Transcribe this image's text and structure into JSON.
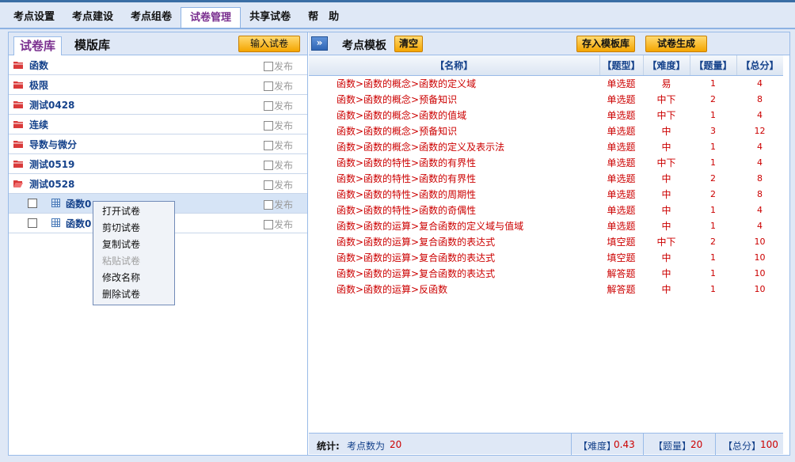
{
  "menu": {
    "tabs": [
      {
        "label": "考点设置"
      },
      {
        "label": "考点建设"
      },
      {
        "label": "考点组卷"
      },
      {
        "label": "试卷管理"
      },
      {
        "label": "共享试卷"
      },
      {
        "label": "帮　助"
      }
    ],
    "active_index": 3
  },
  "left": {
    "tabs": {
      "papers": "试卷库",
      "templates": "模版库"
    },
    "import_button": "输入试卷",
    "publish_label": "发布",
    "folders": [
      {
        "name": "函数"
      },
      {
        "name": "极限"
      },
      {
        "name": "测试0428"
      },
      {
        "name": "连续"
      },
      {
        "name": "导数与微分"
      },
      {
        "name": "测试0519"
      },
      {
        "name": "测试0528"
      }
    ],
    "papers": [
      {
        "name": "函数0"
      },
      {
        "name": "函数0"
      }
    ],
    "context_menu": [
      {
        "label": "打开试卷",
        "enabled": true
      },
      {
        "label": "剪切试卷",
        "enabled": true
      },
      {
        "label": "复制试卷",
        "enabled": true
      },
      {
        "label": "粘贴试卷",
        "enabled": false
      },
      {
        "label": "修改名称",
        "enabled": true
      },
      {
        "label": "删除试卷",
        "enabled": true
      }
    ]
  },
  "right": {
    "expand_icon": "double-chevron-right-icon",
    "title": "考点模板",
    "clear_button": "清空",
    "save_template_button": "存入模板库",
    "generate_button": "试卷生成",
    "columns": {
      "name": "【名称】",
      "type": "【题型】",
      "difficulty": "【难度】",
      "count": "【题量】",
      "score": "【总分】"
    },
    "rows": [
      {
        "name": "函数>函数的概念>函数的定义域",
        "type": "单选题",
        "difficulty": "易",
        "count": "1",
        "score": "4"
      },
      {
        "name": "函数>函数的概念>预备知识",
        "type": "单选题",
        "difficulty": "中下",
        "count": "2",
        "score": "8"
      },
      {
        "name": "函数>函数的概念>函数的值域",
        "type": "单选题",
        "difficulty": "中下",
        "count": "1",
        "score": "4"
      },
      {
        "name": "函数>函数的概念>预备知识",
        "type": "单选题",
        "difficulty": "中",
        "count": "3",
        "score": "12"
      },
      {
        "name": "函数>函数的概念>函数的定义及表示法",
        "type": "单选题",
        "difficulty": "中",
        "count": "1",
        "score": "4"
      },
      {
        "name": "函数>函数的特性>函数的有界性",
        "type": "单选题",
        "difficulty": "中下",
        "count": "1",
        "score": "4"
      },
      {
        "name": "函数>函数的特性>函数的有界性",
        "type": "单选题",
        "difficulty": "中",
        "count": "2",
        "score": "8"
      },
      {
        "name": "函数>函数的特性>函数的周期性",
        "type": "单选题",
        "difficulty": "中",
        "count": "2",
        "score": "8"
      },
      {
        "name": "函数>函数的特性>函数的奇偶性",
        "type": "单选题",
        "difficulty": "中",
        "count": "1",
        "score": "4"
      },
      {
        "name": "函数>函数的运算>复合函数的定义域与值域",
        "type": "单选题",
        "difficulty": "中",
        "count": "1",
        "score": "4"
      },
      {
        "name": "函数>函数的运算>复合函数的表达式",
        "type": "填空题",
        "difficulty": "中下",
        "count": "2",
        "score": "10"
      },
      {
        "name": "函数>函数的运算>复合函数的表达式",
        "type": "填空题",
        "difficulty": "中",
        "count": "1",
        "score": "10"
      },
      {
        "name": "函数>函数的运算>复合函数的表达式",
        "type": "解答题",
        "difficulty": "中",
        "count": "1",
        "score": "10"
      },
      {
        "name": "函数>函数的运算>反函数",
        "type": "解答题",
        "difficulty": "中",
        "count": "1",
        "score": "10"
      }
    ],
    "status": {
      "stats_label": "统计:",
      "count_label": "考点数为",
      "count_value": "20",
      "difficulty_label": "【难度】",
      "difficulty_value": "0.43",
      "quantity_label": "【题量】",
      "quantity_value": "20",
      "score_label": "【总分】",
      "score_value": "100"
    }
  },
  "colors": {
    "accent": "#7a2f8f",
    "link": "#15428b",
    "value_red": "#cc0000",
    "button_orange": "#f4a500",
    "panel_bg": "#dfe8f6"
  }
}
